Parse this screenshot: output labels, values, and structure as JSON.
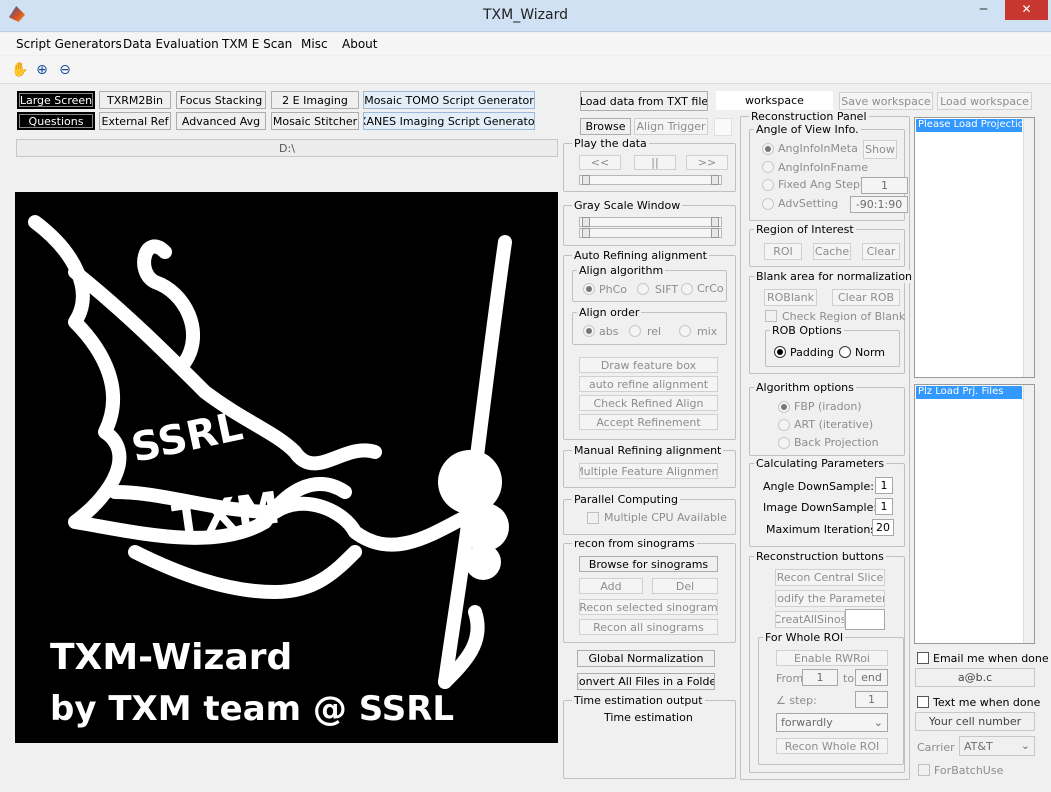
{
  "window": {
    "title": "TXM_Wizard",
    "minimize": "─",
    "maximize": "□",
    "close": "✕"
  },
  "menu": [
    "Script Generators",
    "Data Evaluation",
    "TXM E Scan",
    "Misc",
    "About"
  ],
  "toolbar": {
    "pan": "✋",
    "zoom_in": "⊕",
    "zoom_out": "⊖"
  },
  "top_buttons": {
    "large_screen": "Large Screen",
    "questions": "Questions",
    "txrm2bin": "TXRM2Bin",
    "external_ref": "External Ref",
    "focus_stacking": "Focus Stacking",
    "advanced_avg": "Advanced Avg",
    "e2_imaging": "2 E Imaging",
    "mosaic_stitcher": "Mosaic Stitcher",
    "mosaic_tomo": "Mosaic TOMO Script Generator",
    "xanes_imaging": "XANES Imaging Script Generator"
  },
  "path_display": "D:\\",
  "logo": {
    "line1": "TXM-Wizard",
    "line2": "by TXM team @ SSRL",
    "stamp1": "SSRL",
    "stamp2": "TXM"
  },
  "middle": {
    "load_txt": "Load data from TXT file",
    "browse": "Browse",
    "align_trigger": "Align Trigger",
    "play_title": "Play the data",
    "play_prev": "<<",
    "play_pause": "||",
    "play_next": ">>",
    "gray_title": "Gray Scale Window",
    "auto_title": "Auto Refining alignment",
    "algo_title": "Align algorithm",
    "algo_phco": "PhCo",
    "algo_sift": "SIFT",
    "algo_crco": "CrCo",
    "order_title": "Align order",
    "order_abs": "abs",
    "order_rel": "rel",
    "order_mix": "mix",
    "draw_feature": "Draw feature box",
    "auto_refine": "auto refine alignment",
    "check_refined": "Check Refined Align",
    "accept_refine": "Accept Refinement",
    "manual_title": "Manual Refining alignment",
    "multi_feature": "Multiple Feature Alignment",
    "parallel_title": "Parallel Computing",
    "multi_cpu": "Multiple CPU Available",
    "recon_sino_title": "recon from sinograms",
    "browse_sino": "Browse for sinograms",
    "add": "Add",
    "del": "Del",
    "recon_selected": "Recon selected sinogram",
    "recon_all": "Recon all sinograms",
    "global_norm": "Global Normalization",
    "convert_all": "Convert All Files in a Folder",
    "time_title": "Time estimation output",
    "time_text": "Time estimation"
  },
  "workspace": {
    "name": "workspace",
    "save": "Save workspace",
    "load": "Load workspace"
  },
  "recon": {
    "panel_title": "Reconstruction Panel",
    "aov_title": "Angle of View Info.",
    "ang_meta": "AngInfoInMeta",
    "show": "Show",
    "ang_fname": "AngInfoInFname",
    "fixed_step": "Fixed Ang Step",
    "fixed_step_val": "1",
    "adv_setting": "AdvSetting",
    "adv_val": "-90:1:90",
    "roi_title": "Region of Interest",
    "roi": "ROI",
    "cache": "Cache",
    "clear": "Clear",
    "blank_title": "Blank area for normalization",
    "roblank": "ROBlank",
    "clear_rob": "Clear ROB",
    "check_rob": "Check Region of Blank",
    "rob_options": "ROB Options",
    "padding": "Padding",
    "norm": "Norm",
    "algo_opts": "Algorithm options",
    "fbp": "FBP (iradon)",
    "art": "ART (iterative)",
    "back_proj": "Back Projection",
    "calc_title": "Calculating Parameters",
    "angle_ds": "Angle DownSample:",
    "angle_ds_val": "1",
    "image_ds": "Image DownSample:",
    "image_ds_val": "1",
    "max_iter": "Maximum Iterations:",
    "max_iter_val": "20",
    "btns_title": "Reconstruction buttons",
    "recon_central": "Recon Central Slice",
    "modify_params": "Modify the Parameters",
    "create_sinos": "CreatAllSinos",
    "whole_roi_title": "For Whole ROI",
    "enable_rwroi": "Enable RWRoi",
    "from": "From",
    "from_val": "1",
    "to": "to",
    "end": "end",
    "step": "∠ step:",
    "step_val": "1",
    "direction": "forwardly",
    "recon_whole": "Recon Whole ROI"
  },
  "right": {
    "list1": "Please Load Projection",
    "list2": "Plz Load Prj. Files",
    "email_when_done": "Email me when done",
    "email": "a@b.c",
    "text_when_done": "Text me when done",
    "cell": "Your cell number",
    "carrier_label": "Carrier :",
    "carrier": "AT&T",
    "for_batch": "ForBatchUse"
  }
}
